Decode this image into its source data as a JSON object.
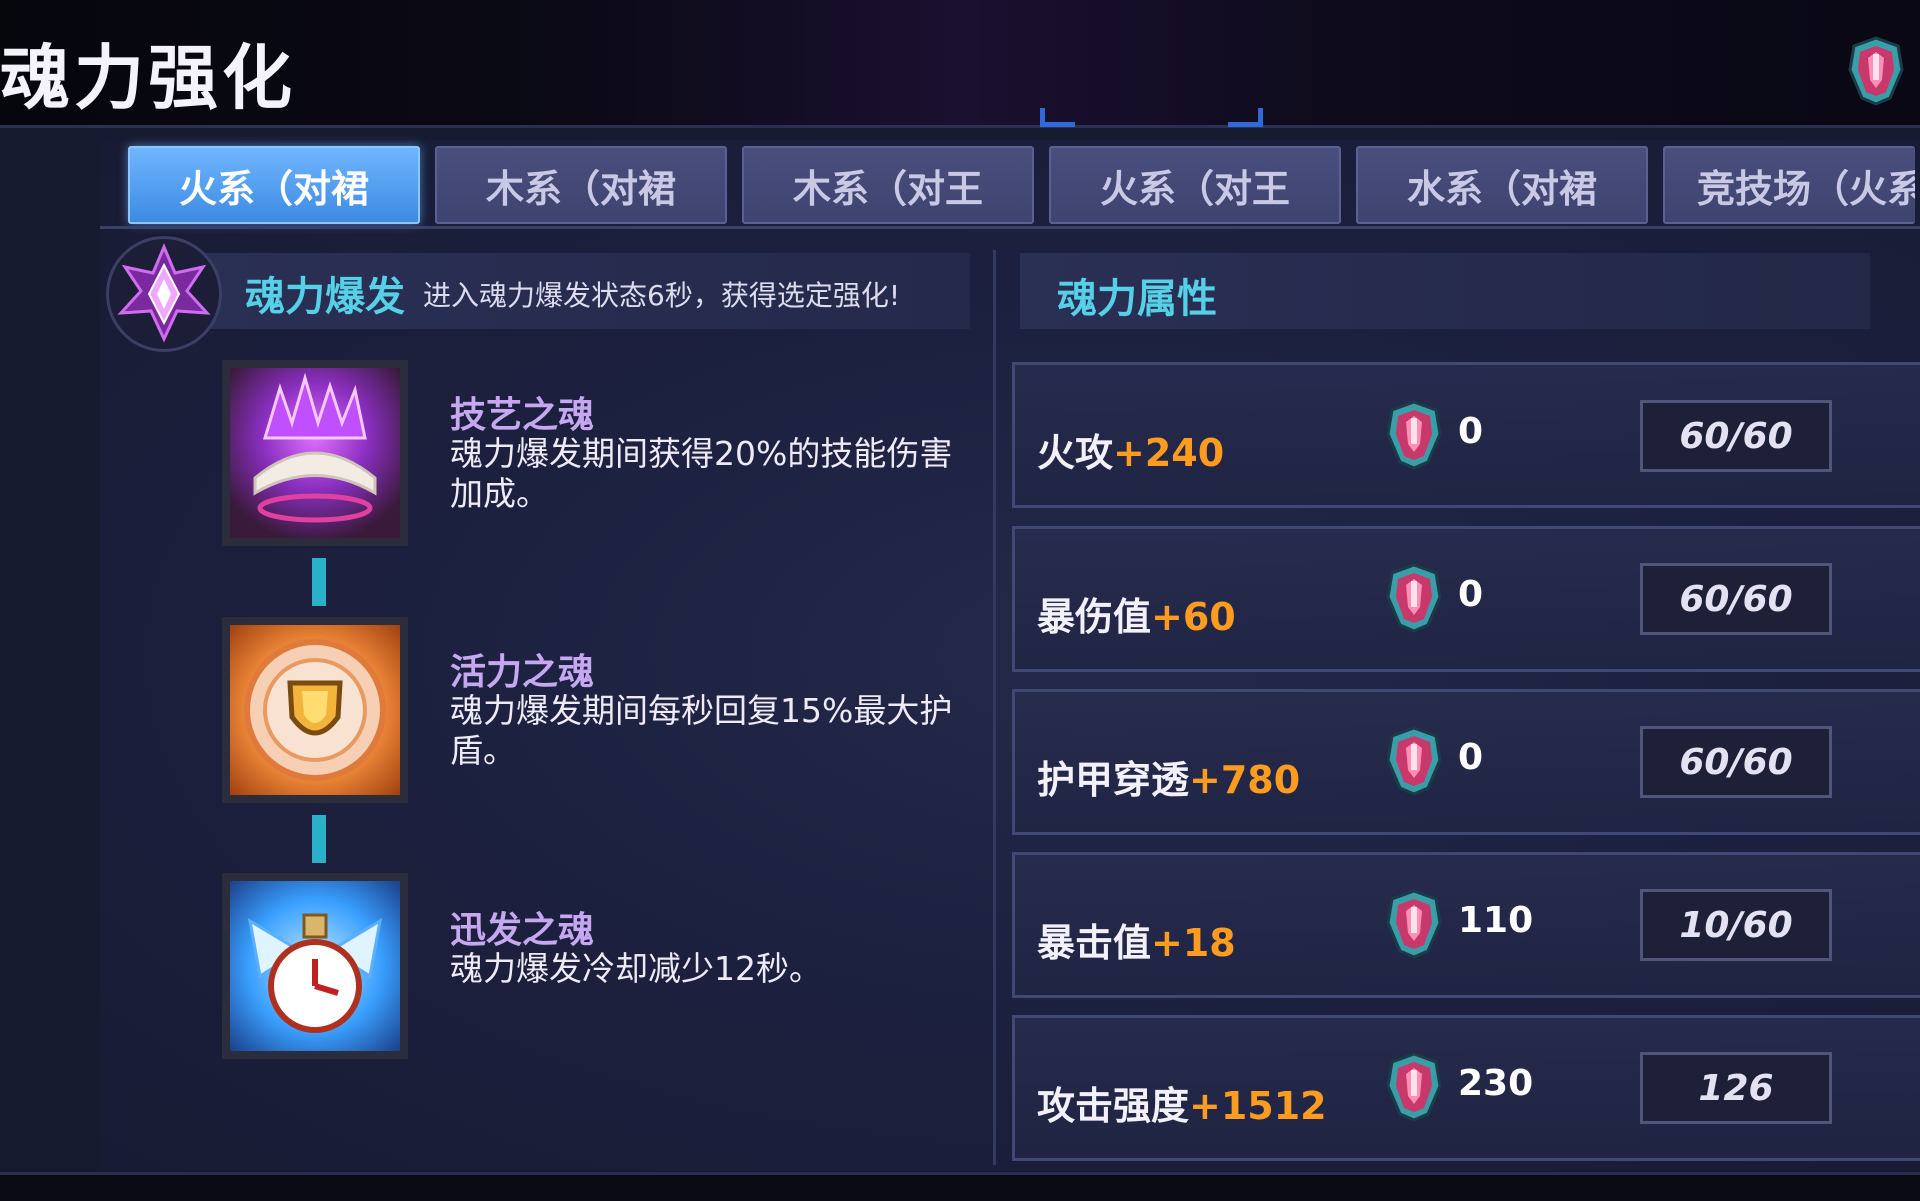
{
  "header": {
    "title": "魂力强化",
    "currency_icon": "soul-gem-icon"
  },
  "tabs": [
    {
      "label": "火系（对裙",
      "active": true
    },
    {
      "label": "木系（对裙",
      "active": false
    },
    {
      "label": "木系（对王",
      "active": false
    },
    {
      "label": "火系（对王",
      "active": false
    },
    {
      "label": "水系（对裙",
      "active": false
    },
    {
      "label": "竞技场（火系",
      "active": false
    }
  ],
  "burst": {
    "title": "魂力爆发",
    "description": "进入魂力爆发状态6秒，获得选定强化!",
    "icon": "purple-star-crystal-icon"
  },
  "skills": [
    {
      "name": "技艺之魂",
      "description": "魂力爆发期间获得20%的技能伤害加成。",
      "icon": "purple-flame-book-icon"
    },
    {
      "name": "活力之魂",
      "description": "魂力爆发期间每秒回复15%最大护盾。",
      "icon": "golden-shield-icon"
    },
    {
      "name": "迅发之魂",
      "description": "魂力爆发冷却减少12秒。",
      "icon": "winged-clock-icon"
    }
  ],
  "attributes": {
    "title": "魂力属性",
    "rows": [
      {
        "label": "火攻",
        "bonus": "+240",
        "cost": "0",
        "level": "60/60"
      },
      {
        "label": "暴伤值",
        "bonus": "+60",
        "cost": "0",
        "level": "60/60"
      },
      {
        "label": "护甲穿透",
        "bonus": "+780",
        "cost": "0",
        "level": "60/60"
      },
      {
        "label": "暴击值",
        "bonus": "+18",
        "cost": "110",
        "level": "10/60"
      },
      {
        "label": "攻击强度",
        "bonus": "+1512",
        "cost": "230",
        "level": "126"
      }
    ]
  },
  "colors": {
    "accent_cyan": "#55d0e6",
    "bonus_orange": "#ff9c1f",
    "tab_active": "#4f9cf0",
    "skill_name_purple": "#c6a8f0"
  }
}
